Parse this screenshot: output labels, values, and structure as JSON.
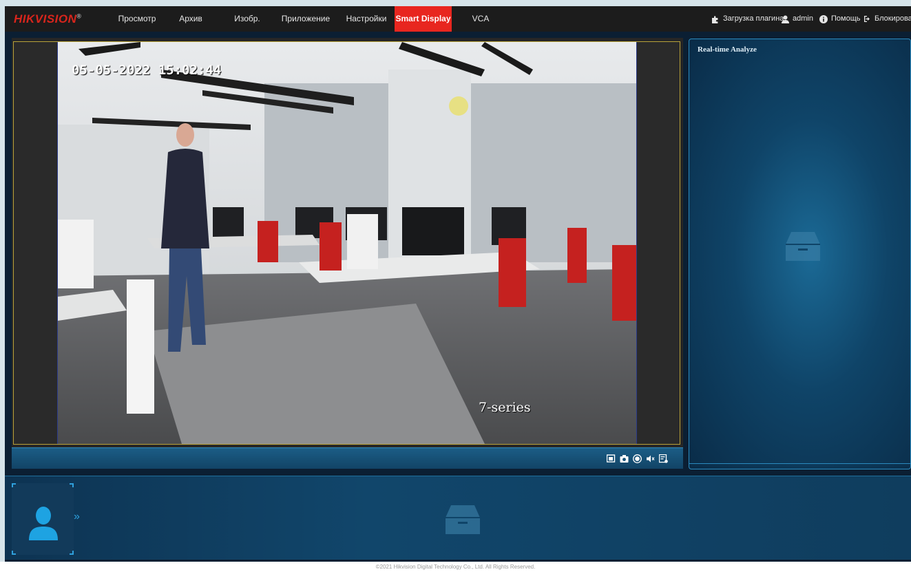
{
  "app": {
    "logo": "HIKVISION",
    "logo_mark": "®"
  },
  "nav": {
    "items": [
      {
        "label": "Просмотр"
      },
      {
        "label": "Архив"
      },
      {
        "label": "Изобр."
      },
      {
        "label": "Приложение"
      },
      {
        "label": "Настройки"
      },
      {
        "label": "Smart Display",
        "active": true
      },
      {
        "label": "VCA"
      }
    ]
  },
  "tools": {
    "plugin": "Загрузка плагина",
    "user": "admin",
    "help": "Помощь",
    "lock": "Блокировать"
  },
  "video": {
    "osd_datetime": "05-05-2022 15:02:44",
    "osd_camera_name": "7-series"
  },
  "realtime_panel": {
    "title": "Real-time Analyze"
  },
  "footer": {
    "copyright": "©2021 Hikvision Digital Technology Co., Ltd. All Rights Reserved."
  },
  "colors": {
    "accent": "#e8261f",
    "panel_border": "#2b8bc0",
    "topbar": "#1c1c1c"
  }
}
